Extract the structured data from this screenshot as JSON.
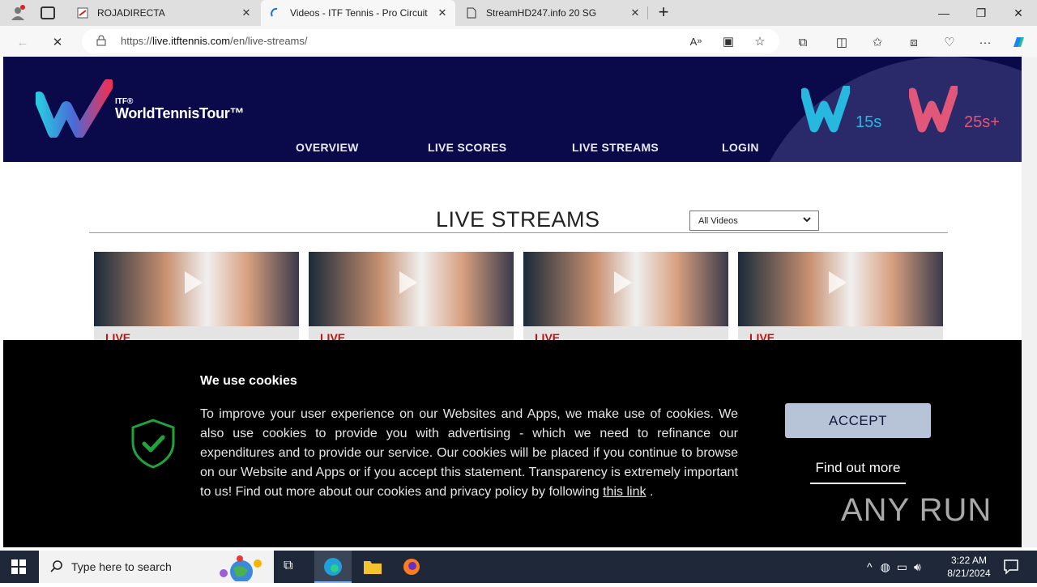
{
  "browser": {
    "tabs": [
      {
        "title": "ROJADIRECTA",
        "active": false
      },
      {
        "title": "Videos - ITF Tennis - Pro Circuit",
        "active": true
      },
      {
        "title": "StreamHD247.info 20 SG",
        "active": false
      }
    ],
    "url_prefix": "https://",
    "url_domain": "live.itftennis.com",
    "url_path": "/en/live-streams/"
  },
  "site": {
    "logo_itf": "ITF®",
    "logo_name": "WorldTennisTour™",
    "nav": [
      "OVERVIEW",
      "LIVE SCORES",
      "LIVE STREAMS",
      "LOGIN"
    ],
    "badge_15": "15s",
    "badge_25": "25s+",
    "section_title": "LIVE STREAMS",
    "filter_selected": "All Videos",
    "cards": [
      {
        "badge": "LIVE"
      },
      {
        "badge": "LIVE"
      },
      {
        "badge": "LIVE"
      },
      {
        "badge": "LIVE"
      }
    ]
  },
  "cookie": {
    "title": "We use cookies",
    "body": "To improve your user experience on our Websites and Apps, we make use of cookies. We also use cookies to provide you with advertising - which we need to refinance our expenditures and to provide our service. Our cookies will be placed if you continue to browse on our Website and Apps or if you accept this statement. Transparency is extremely important to us! Find out more about our cookies and privacy policy by following",
    "link_text": "this link",
    "trail": ".",
    "accept": "ACCEPT",
    "find_out": "Find out more"
  },
  "watermark": "ANY RUN",
  "taskbar": {
    "search_placeholder": "Type here to search",
    "time": "3:22 AM",
    "date": "8/21/2024"
  },
  "colors": {
    "hero_bg": "#0a0a4a",
    "accept_bg": "#b7c3d6",
    "shield_green": "#1fa33a"
  }
}
